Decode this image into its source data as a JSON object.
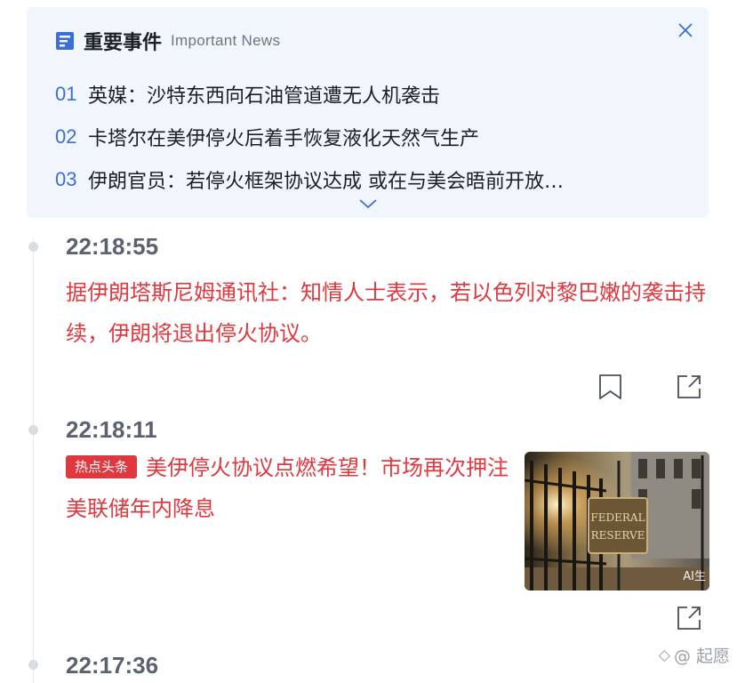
{
  "important_news": {
    "title_cn": "重要事件",
    "title_en": "Important News",
    "items": [
      {
        "num": "01",
        "text": "英媒：沙特东西向石油管道遭无人机袭击"
      },
      {
        "num": "02",
        "text": "卡塔尔在美伊停火后着手恢复液化天然气生产"
      },
      {
        "num": "03",
        "text": "伊朗官员：若停火框架协议达成 或在与美会晤前开放…"
      }
    ]
  },
  "feed": [
    {
      "time": "22:18:55",
      "headline": "据伊朗塔斯尼姆通讯社：知情人士表示，若以色列对黎巴嫩的袭击持续，伊朗将退出停火协议。"
    },
    {
      "time": "22:18:11",
      "tag": "热点头条",
      "headline": "美伊停火协议点燃希望！市场再次押注美联储年内降息",
      "image_sign_text": "FEDERAL RESERVE",
      "image_badge": "AI生"
    },
    {
      "time": "22:17:36"
    }
  ],
  "watermark": {
    "mark": "◇",
    "text": "@ 起愿"
  },
  "colors": {
    "accent_blue": "#3b6fd6",
    "headline_red": "#e0383f",
    "card_bg": "#f1f5fc"
  }
}
